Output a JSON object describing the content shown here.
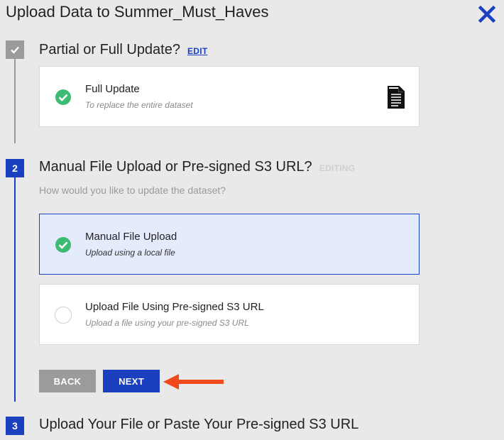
{
  "dialog": {
    "title": "Upload Data to Summer_Must_Haves",
    "close_icon": "close-icon",
    "accent_color": "#1a3fbf"
  },
  "steps": [
    {
      "marker": "check-icon",
      "state": "completed",
      "heading": "Partial or Full Update?",
      "action_label": "EDIT",
      "selected_option": {
        "title": "Full Update",
        "subtitle": "To replace the entire dataset",
        "status_icon": "check-circle-icon",
        "trailing_icon": "document-icon"
      }
    },
    {
      "marker": "2",
      "state": "editing",
      "heading": "Manual File Upload or Pre-signed S3 URL?",
      "status_label": "EDITING",
      "question": "How would you like to update the dataset?",
      "options": [
        {
          "title": "Manual File Upload",
          "subtitle": "Upload using a local file",
          "selected": true,
          "status_icon": "check-circle-icon"
        },
        {
          "title": "Upload File Using Pre-signed S3 URL",
          "subtitle": "Upload a file using your pre-signed S3 URL",
          "selected": false,
          "status_icon": "radio-empty-icon"
        }
      ],
      "buttons": {
        "back_label": "BACK",
        "next_label": "NEXT"
      }
    },
    {
      "marker": "3",
      "state": "pending",
      "heading": "Upload Your File or Paste Your Pre-signed S3 URL"
    }
  ],
  "annotation": {
    "icon": "red-arrow-icon",
    "color": "#f04a1c"
  }
}
